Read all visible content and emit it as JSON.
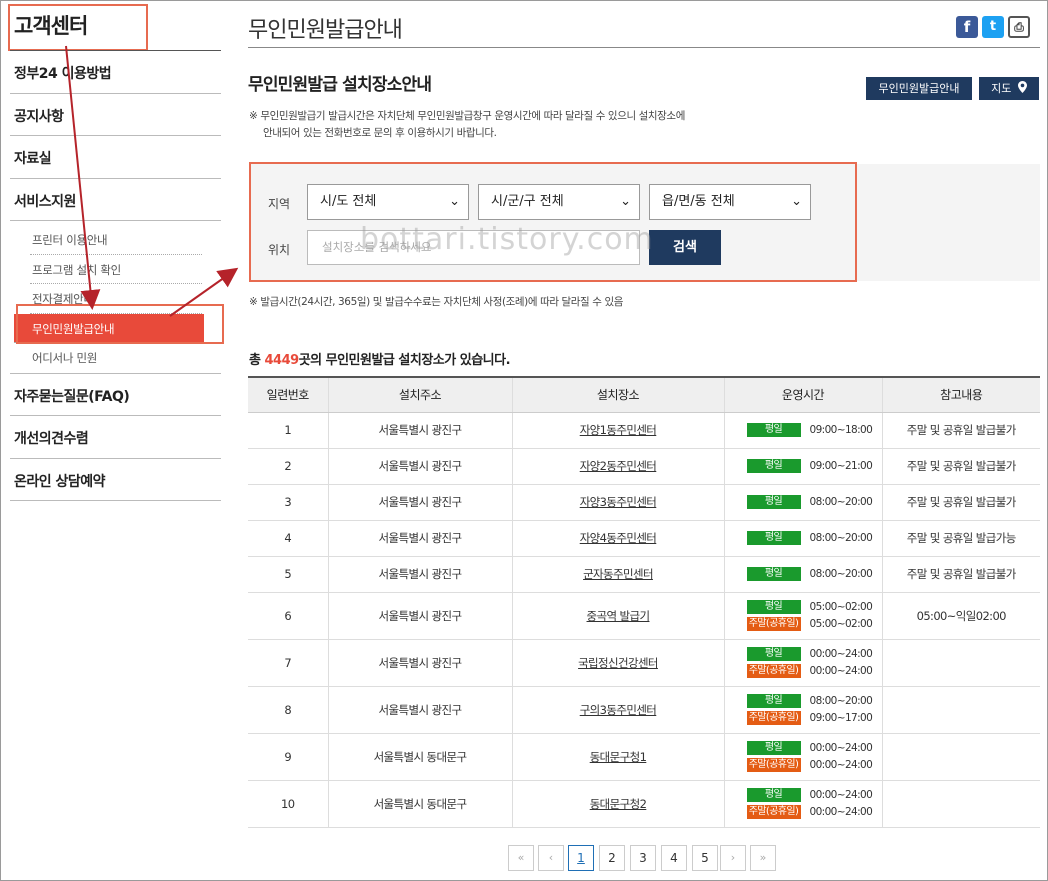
{
  "sidebar": {
    "title": "고객센터",
    "items": [
      {
        "label": "정부24 이용방법"
      },
      {
        "label": "공지사항"
      },
      {
        "label": "자료실"
      },
      {
        "label": "서비스지원"
      }
    ],
    "sub_items": [
      {
        "label": "프린터 이용안내"
      },
      {
        "label": "프로그램 설치 확인"
      },
      {
        "label": "전자결제안내"
      },
      {
        "label": "무인민원발급안내"
      },
      {
        "label": "어디서나 민원"
      }
    ],
    "bottom_items": [
      {
        "label": "자주묻는질문(FAQ)"
      },
      {
        "label": "개선의견수렴"
      },
      {
        "label": "온라인 상담예약"
      }
    ]
  },
  "header": {
    "title": "무인민원발급안내",
    "share": {
      "facebook": "f",
      "twitter": "t",
      "print": "⎙"
    }
  },
  "section": {
    "title": "무인민원발급 설치장소안내",
    "guide_button": "무인민원발급안내",
    "map_button": "지도",
    "notice_line1": "※ 무인민원발급기 발급시간은 자치단체 무인민원발급창구 운영시간에 따라 달라질 수 있으니 설치장소에",
    "notice_line2": "안내되어 있는 전화번호로 문의 후 이용하시기 바랍니다."
  },
  "search": {
    "region_label": "지역",
    "location_label": "위치",
    "select_sido": "시/도 전체",
    "select_sigungu": "시/군/구 전체",
    "select_eupmyeondong": "읍/면/동 전체",
    "placeholder": "설치장소를 검색하세요",
    "button": "검색",
    "watermark": "bottari.tistory.com"
  },
  "note2": "※ 발급시간(24시간, 365일) 및 발급수수료는 자치단체 사정(조례)에 따라 달라질 수 있음",
  "total": {
    "prefix": "총 ",
    "count": "4449",
    "suffix": "곳의 무인민원발급 설치장소가 있습니다."
  },
  "table": {
    "headers": [
      "일련번호",
      "설치주소",
      "설치장소",
      "운영시간",
      "참고내용"
    ],
    "weekday_label": "평일",
    "weekend_label": "주말(공휴일)",
    "rows": [
      {
        "no": "1",
        "addr": "서울특별시 광진구",
        "place": "자양1동주민센터",
        "weekday": "09:00~18:00",
        "weekend": null,
        "note": "주말 및 공휴일 발급불가"
      },
      {
        "no": "2",
        "addr": "서울특별시 광진구",
        "place": "자양2동주민센터",
        "weekday": "09:00~21:00",
        "weekend": null,
        "note": "주말 및 공휴일 발급불가"
      },
      {
        "no": "3",
        "addr": "서울특별시 광진구",
        "place": "자양3동주민센터",
        "weekday": "08:00~20:00",
        "weekend": null,
        "note": "주말 및 공휴일 발급불가"
      },
      {
        "no": "4",
        "addr": "서울특별시 광진구",
        "place": "자양4동주민센터",
        "weekday": "08:00~20:00",
        "weekend": null,
        "note": "주말 및 공휴일 발급가능"
      },
      {
        "no": "5",
        "addr": "서울특별시 광진구",
        "place": "군자동주민센터",
        "weekday": "08:00~20:00",
        "weekend": null,
        "note": "주말 및 공휴일 발급불가"
      },
      {
        "no": "6",
        "addr": "서울특별시 광진구",
        "place": "중곡역 발급기",
        "weekday": "05:00~02:00",
        "weekend": "05:00~02:00",
        "note": "05:00~익일02:00"
      },
      {
        "no": "7",
        "addr": "서울특별시 광진구",
        "place": "국립정신건강센터",
        "weekday": "00:00~24:00",
        "weekend": "00:00~24:00",
        "note": ""
      },
      {
        "no": "8",
        "addr": "서울특별시 광진구",
        "place": "구의3동주민센터",
        "weekday": "08:00~20:00",
        "weekend": "09:00~17:00",
        "note": ""
      },
      {
        "no": "9",
        "addr": "서울특별시 동대문구",
        "place": "동대문구청1",
        "weekday": "00:00~24:00",
        "weekend": "00:00~24:00",
        "note": ""
      },
      {
        "no": "10",
        "addr": "서울특별시 동대문구",
        "place": "동대문구청2",
        "weekday": "00:00~24:00",
        "weekend": "00:00~24:00",
        "note": ""
      }
    ]
  },
  "pagination": {
    "first": "«",
    "prev": "‹",
    "next": "›",
    "last": "»",
    "pages": [
      "1",
      "2",
      "3",
      "4",
      "5"
    ],
    "current": "1"
  },
  "colors": {
    "accent": "#e84a3a",
    "navy": "#1f3a5f",
    "weekday": "#1a9a2d",
    "weekend": "#e45c14",
    "annotation": "#c0282b"
  }
}
